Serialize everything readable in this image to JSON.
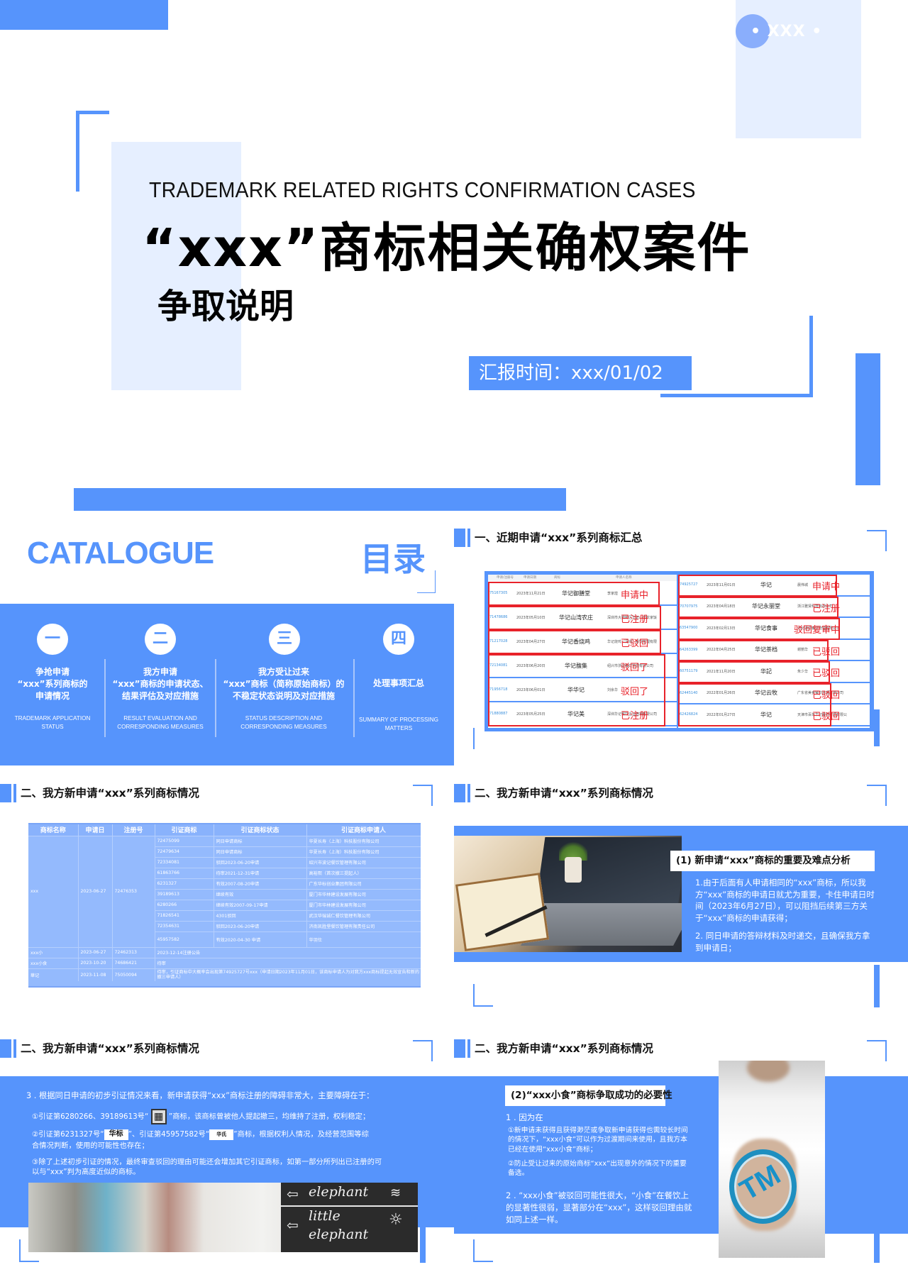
{
  "cover": {
    "badge": "• XXX •",
    "title_en": "TRADEMARK RELATED RIGHTS CONFIRMATION CASES",
    "title_cn": "“xxx”商标相关确权案件",
    "subtitle": "争取说明",
    "report_time": "汇报时间：xxx/01/02"
  },
  "catalogue": {
    "title_en": "CATALOGUE",
    "title_cn": "目录",
    "items": [
      {
        "num": "一",
        "cn": [
          "争抢申请",
          "“xxx”系列商标的",
          "申请情况"
        ],
        "en": [
          "TRADEMARK APPLICATION",
          "STATUS"
        ]
      },
      {
        "num": "二",
        "cn": [
          "我方申请",
          "“xxx”商标的申请状态、",
          "结果评估及对应措施"
        ],
        "en": [
          "RESULT EVALUATION AND",
          "CORRESPONDING MEASURES"
        ]
      },
      {
        "num": "三",
        "cn": [
          "我方受让过来",
          "“xxx”商标（简称原始商标）的",
          "不稳定状态说明及对应措施"
        ],
        "en": [
          "STATUS DESCRIPTION AND",
          "CORRESPONDING MEASURES"
        ]
      },
      {
        "num": "四",
        "cn": [
          "处理事项汇总"
        ],
        "en": [
          "SUMMARY OF PROCESSING",
          "MATTERS"
        ]
      }
    ]
  },
  "summary": {
    "heading": "一、近期申请“xxx”系列商标汇总",
    "columns": [
      "申请/注册号",
      "申请日期",
      "商标",
      "申请人名称"
    ],
    "left_rows": [
      {
        "regno": "75167305",
        "date": "2023年11月21日",
        "mark": "华记御膳堂",
        "applicant": "李家煌",
        "status": "申请中"
      },
      {
        "regno": "71478686",
        "date": "2023年05月10日",
        "mark": "华记山湾农庄",
        "applicant": "深圳市大鹏新区华记山湾农家饭店",
        "status": "已注册"
      },
      {
        "regno": "71217028",
        "date": "2023年04月27日",
        "mark": "华记香烧鸡",
        "applicant": "华记烧鸡（深圳）餐饮管理有限公司",
        "status": "已驳回"
      },
      {
        "regno": "72134081",
        "date": "2023年06月20日",
        "mark": "华记馥集",
        "applicant": "绍兴市浙记餐饮管理有限公司",
        "status": "驳回了"
      },
      {
        "regno": "71956718",
        "date": "2023年06月01日",
        "mark": "华华记",
        "applicant": "刘余华",
        "status": "驳回了"
      },
      {
        "regno": "71880887",
        "date": "2023年05月25日",
        "mark": "华记美",
        "applicant": "深圳华记餐饮企业连锁有限公司",
        "status": "已注册"
      }
    ],
    "right_rows": [
      {
        "regno": "74925727",
        "date": "2023年11月01日",
        "mark": "华记",
        "applicant": "晨伟城",
        "status": "申请中"
      },
      {
        "regno": "70707975",
        "date": "2023年04月18日",
        "mark": "华记永丽堂",
        "applicant": "浙江雅贤科技有限公司",
        "status": "已注册"
      },
      {
        "regno": "63547900",
        "date": "2023年02月13日",
        "mark": "华记食事",
        "applicant": "河北通信餐饮管理有限公司",
        "status": "驳回复审中"
      },
      {
        "regno": "64263399",
        "date": "2022年04月25日",
        "mark": "华记茶档",
        "applicant": "谢丽华",
        "status": "已驳回"
      },
      {
        "regno": "60751179",
        "date": "2021年11月20日",
        "mark": "华記",
        "applicant": "朱少华",
        "status": "已驳回"
      },
      {
        "regno": "62445140",
        "date": "2022年01月26日",
        "mark": "华记云牧",
        "applicant": "广东省美食餐饮管理有限公司",
        "status": "已驳回"
      },
      {
        "regno": "62426824",
        "date": "2022年01月27日",
        "mark": "华记",
        "applicant": "天津市百年华记餐饮管理有限公司",
        "status": "已驳回"
      }
    ]
  },
  "cited": {
    "heading": "二、我方新申请“xxx”系列商标情况",
    "columns": [
      "商标名称",
      "申请日",
      "注册号",
      "引证商标",
      "引证商标状态",
      "引证商标申请人"
    ],
    "main": {
      "name": "xxx",
      "date": "2023-06-27",
      "regno": "72476353"
    },
    "cites": [
      [
        "72475099",
        "同日申请商标",
        "华夏长寿（上海）科技股份有限公司"
      ],
      [
        "72479634",
        "同日申请商标",
        "华夏长寿（上海）科技股份有限公司"
      ],
      [
        "72334081",
        "驳回2023-06-20申请",
        "绍兴市波记餐饮管理有限公司"
      ],
      [
        "61863766",
        "待审2021-12-31申请",
        "高裕熙（首次撤三提起人）"
      ],
      [
        "6231327",
        "有效2007-08-20申请",
        "广东华标创业集团有限公司"
      ],
      [
        "39189613",
        "继续有效",
        "厦门市华林建设发展有限公司"
      ],
      [
        "6280266",
        "继续有效2007-09-17申请",
        "厦门市华林建设发展有限公司"
      ],
      [
        "71826541",
        "4301驳回",
        "武汉华瑞诚仁餐饮管理有限公司"
      ],
      [
        "72354631",
        "驳回2023-06-20申请",
        "济南凯胜堡餐饮管理有限责任公司"
      ],
      [
        "45957582",
        "有效2020-04-30 申请",
        "华羽仕"
      ]
    ],
    "others": [
      {
        "name": "xxx小",
        "date": "2023-06-27",
        "regno": "72462313",
        "note": "2023-12-14注册公告"
      },
      {
        "name": "xxx小食",
        "date": "2023-10-20",
        "regno": "74686421",
        "note": "待审"
      },
      {
        "name": "華记",
        "date": "2023-11-08",
        "regno": "75050094",
        "note": "待审，引证商标中大概率会出现第74925727号xxx（申请日期2023年11月01日，该商标申请人为对我方xxx商标提起无效宣告和新的撤三申请人）"
      }
    ]
  },
  "analysis": {
    "heading": "二、我方新申请“xxx”系列商标情况",
    "title": "(1) 新申请“xxx”商标的重要及难点分析",
    "p1": "1.由于后面有人申请相同的“xxx”商标，所以我方“xxx”商标的申请日就尤为重要，卡住申请日时间（2023年6月27日），可以阻挡后续第三方关于“xxx”商标的申请获得；",
    "p2": "2. 同日申请的答辩材料及时递交，且确保我方拿到申请日；"
  },
  "obstacles": {
    "heading": "二、我方新申请“xxx”系列商标情况",
    "intro": "3 . 根据同日申请的初步引证情况来看，新申请获得“xxx”商标注册的障碍非常大，主要障碍在于：",
    "item1_pre": "①引证第6280266、39189613号“",
    "item1_post": "”商标，该商标曾被他人提起撤三，均维持了注册，权利稳定；",
    "item2_a": "②引证第6231327号“",
    "item2_mark1": "华标",
    "item2_b": "”、引证第45957582号“",
    "item2_mark2": "华氏",
    "item2_c": "”商标，根据权利人情况，及经营范围等综",
    "item2_d": "合情况判断，使用的可能性也存在；",
    "item3_a": "③除了上述初步引证的情况，最终审查驳回的理由可能还会增加其它引证商标，如第一部分所列出已注册的可",
    "item3_b": "以与“xxx”判为高度近似的商标。",
    "chalk1": "elephant",
    "chalk2": "little",
    "chalk3": "elephant"
  },
  "necessity": {
    "heading": "二、我方新申请“xxx”系列商标情况",
    "title": "(2)“xxx小食”商标争取成功的必要性",
    "p1": "1 . 因为在",
    "p1a": "①新申请未获得且获得渺茫或争取新申请获得也需较长时间的情况下，“xxx小食”可以作为过渡期间来使用，且我方本已经在使用“xxx小食”商标；",
    "p1b": "②防止受让过来的原始商标“xxx”出现意外的情况下的重要备选。",
    "p2": "2 . “xxx小食”被驳回可能性很大，“小食”在餐饮上的显著性很弱，显著部分在“xxx”，这样驳回理由就如同上述一样。",
    "tm_text": "TM"
  }
}
